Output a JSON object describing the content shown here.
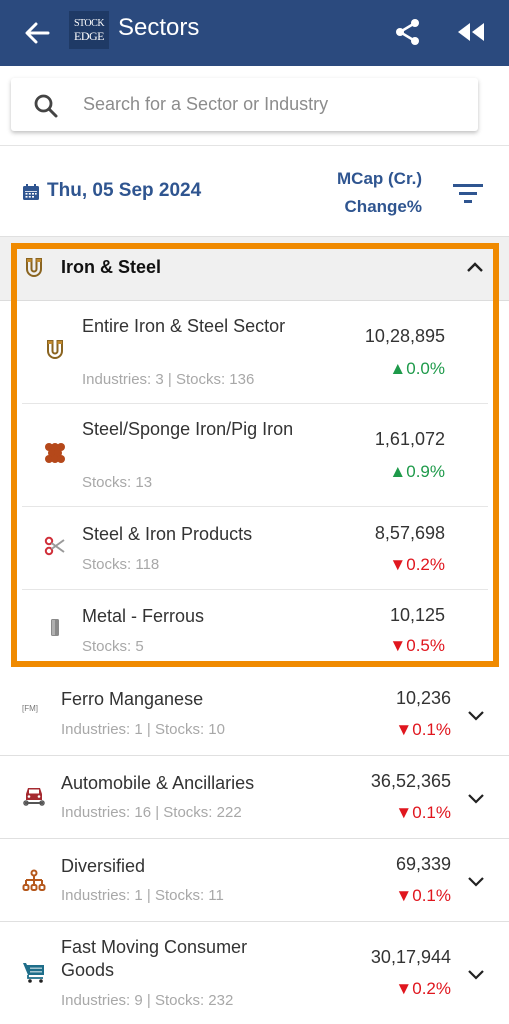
{
  "appbar": {
    "title": "Sectors",
    "logo_line1": "STOCK",
    "logo_line2": "EDGE",
    "back_icon": "arrow-left-icon",
    "share_icon": "share-icon",
    "rewind_icon": "rewind-icon",
    "bg_color": "#2b4a7e"
  },
  "search": {
    "placeholder": "Search for a Sector or Industry",
    "value": ""
  },
  "datebar": {
    "date": "Thu, 05 Sep 2024",
    "mcap_label": "MCap (Cr.)",
    "change_label": "Change%"
  },
  "expanded_sector": {
    "title": "Iron & Steel",
    "icon": "magnet-icon",
    "highlight_color": "#f08a00",
    "items": [
      {
        "name": "Entire Iron & Steel Sector",
        "meta": "Industries: 3 | Stocks: 136",
        "mcap": "10,28,895",
        "change": "▲0.0%",
        "direction": "up",
        "icon": "magnet-icon"
      },
      {
        "name": "Steel/Sponge Iron/Pig Iron",
        "meta": "Stocks: 13",
        "mcap": "1,61,072",
        "change": "▲0.9%",
        "direction": "up",
        "icon": "iron-ore-icon"
      },
      {
        "name": "Steel & Iron Products",
        "meta": "Stocks: 118",
        "mcap": "8,57,698",
        "change": "▼0.2%",
        "direction": "down",
        "icon": "scissors-icon"
      },
      {
        "name": "Metal - Ferrous",
        "meta": "Stocks: 5",
        "mcap": "10,125",
        "change": "▼0.5%",
        "direction": "down",
        "icon": "metal-bar-icon"
      }
    ]
  },
  "sectors": [
    {
      "name": "Ferro Manganese",
      "meta": "Industries: 1 | Stocks: 10",
      "mcap": "10,236",
      "change": "▼0.1%",
      "direction": "down",
      "icon": "fm-text-icon",
      "icon_text": "[FM]"
    },
    {
      "name": "Automobile & Ancillaries",
      "meta": "Industries: 16 | Stocks: 222",
      "mcap": "36,52,365",
      "change": "▼0.1%",
      "direction": "down",
      "icon": "car-repair-icon"
    },
    {
      "name": "Diversified",
      "meta": "Industries: 1 | Stocks: 11",
      "mcap": "69,339",
      "change": "▼0.1%",
      "direction": "down",
      "icon": "hierarchy-icon"
    },
    {
      "name": "Fast Moving Consumer Goods",
      "meta": "Industries: 9 | Stocks: 232",
      "mcap": "30,17,944",
      "change": "▼0.2%",
      "direction": "down",
      "icon": "shopping-cart-icon"
    }
  ],
  "colors": {
    "positive": "#1e9a4a",
    "negative": "#e0161e",
    "accent": "#2f5590"
  }
}
